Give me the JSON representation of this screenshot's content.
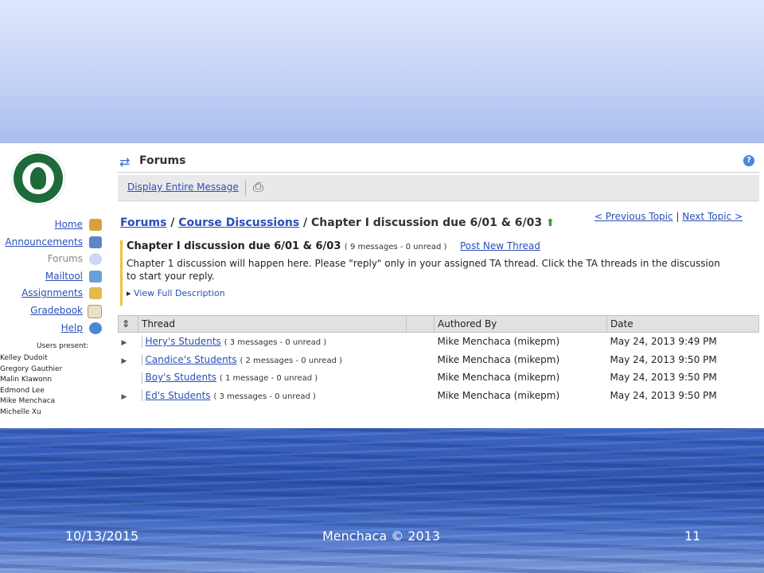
{
  "app": {
    "section_title": "Forums"
  },
  "toolbar": {
    "display_entire_message": "Display Entire Message"
  },
  "nav": {
    "items": [
      {
        "label": "Home"
      },
      {
        "label": "Announcements"
      },
      {
        "label": "Forums"
      },
      {
        "label": "Mailtool"
      },
      {
        "label": "Assignments"
      },
      {
        "label": "Gradebook"
      },
      {
        "label": "Help"
      }
    ],
    "users_present_label": "Users present:",
    "users": [
      "Kelley Dudoit",
      "Gregory Gauthier",
      "Malin Klawonn",
      "Edmond Lee",
      "Mike Menchaca",
      "Michelle Xu"
    ]
  },
  "breadcrumb": {
    "forums": "Forums",
    "sep1": " / ",
    "course": "Course Discussions",
    "sep2": " / ",
    "topic": "Chapter I discussion due 6/01 & 6/03"
  },
  "topic_nav": {
    "prev": "< Previous Topic",
    "sep": " | ",
    "next": "Next Topic >"
  },
  "topic": {
    "title": "Chapter I discussion due 6/01 & 6/03",
    "meta": "( 9 messages - 0 unread )",
    "post_new": "Post New Thread",
    "description_line1": "Chapter 1 discussion will happen here. Please \"reply\" only in your assigned TA thread. Click the TA threads in the discussion",
    "description_line2": "to start your reply.",
    "view_full": "View Full Description"
  },
  "table": {
    "headers": {
      "thread": "Thread",
      "author": "Authored By",
      "date": "Date"
    },
    "rows": [
      {
        "title": "Hery's Students",
        "meta": "( 3 messages - 0 unread )",
        "author": "Mike Menchaca (mikepm)",
        "date": "May 24, 2013 9:49 PM"
      },
      {
        "title": "Candice's Students",
        "meta": "( 2 messages - 0 unread )",
        "author": "Mike Menchaca (mikepm)",
        "date": "May 24, 2013 9:50 PM"
      },
      {
        "title": "Boy's Students",
        "meta": "( 1 message - 0 unread )",
        "author": "Mike Menchaca (mikepm)",
        "date": "May 24, 2013 9:50 PM"
      },
      {
        "title": "Ed's Students",
        "meta": "( 3 messages - 0 unread )",
        "author": "Mike Menchaca (mikepm)",
        "date": "May 24, 2013 9:50 PM"
      }
    ]
  },
  "footer": {
    "date": "10/13/2015",
    "credit": "Menchaca © 2013",
    "page": "11"
  },
  "colors": {
    "link": "#2a4fb8",
    "accent_bar": "#f2c230",
    "logo_green": "#1f6a3a"
  },
  "icons": [
    "swap-arrows-icon",
    "help-icon",
    "print-icon",
    "home-icon",
    "announcements-icon",
    "forums-icon",
    "mailtool-icon",
    "assignments-icon",
    "gradebook-icon",
    "help-nav-icon",
    "green-up-arrow-icon",
    "expand-triangle-icon",
    "sort-arrows-icon"
  ]
}
